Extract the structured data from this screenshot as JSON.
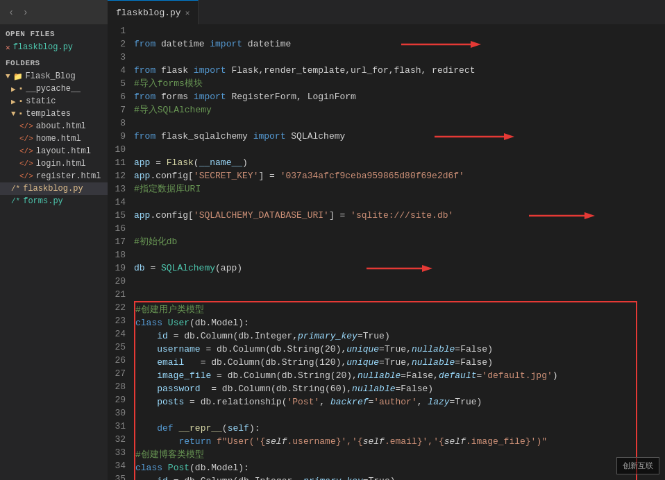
{
  "app_title": "flaskblog.py",
  "tabs": [
    {
      "label": "flaskblog.py",
      "active": true
    }
  ],
  "sidebar": {
    "open_files_title": "OPEN FILES",
    "folders_title": "FOLDERS",
    "open_files": [
      {
        "name": "flaskblog.py",
        "type": "modified",
        "indent": 0
      }
    ],
    "tree": [
      {
        "name": "Flask_Blog",
        "type": "folder",
        "indent": 0
      },
      {
        "name": "__pycache__",
        "type": "folder",
        "indent": 1
      },
      {
        "name": "static",
        "type": "folder",
        "indent": 1
      },
      {
        "name": "templates",
        "type": "folder",
        "indent": 1
      },
      {
        "name": "about.html",
        "type": "html",
        "indent": 2
      },
      {
        "name": "home.html",
        "type": "html",
        "indent": 2
      },
      {
        "name": "layout.html",
        "type": "html",
        "indent": 2
      },
      {
        "name": "login.html",
        "type": "html",
        "indent": 2
      },
      {
        "name": "register.html",
        "type": "html",
        "indent": 2
      },
      {
        "name": "flaskblog.py",
        "type": "py_active",
        "indent": 1
      },
      {
        "name": "forms.py",
        "type": "py",
        "indent": 1
      }
    ]
  },
  "code": {
    "lines": [
      {
        "num": 1,
        "has_arrow": true,
        "arrow_line": true
      },
      {
        "num": 2,
        "has_arrow": false
      },
      {
        "num": 3,
        "has_arrow": false
      },
      {
        "num": 4,
        "has_arrow": false
      },
      {
        "num": 5,
        "has_arrow": false
      },
      {
        "num": 6,
        "has_arrow": true,
        "arrow_line": true
      },
      {
        "num": 7,
        "has_arrow": false
      },
      {
        "num": 8,
        "has_arrow": false
      },
      {
        "num": 9,
        "has_arrow": false
      },
      {
        "num": 10,
        "has_arrow": true,
        "arrow_line": true
      },
      {
        "num": 11,
        "has_arrow": false
      },
      {
        "num": 12,
        "has_arrow": true,
        "arrow_line": true
      },
      {
        "num": 13,
        "has_arrow": false
      }
    ]
  },
  "watermark": "创新互联"
}
